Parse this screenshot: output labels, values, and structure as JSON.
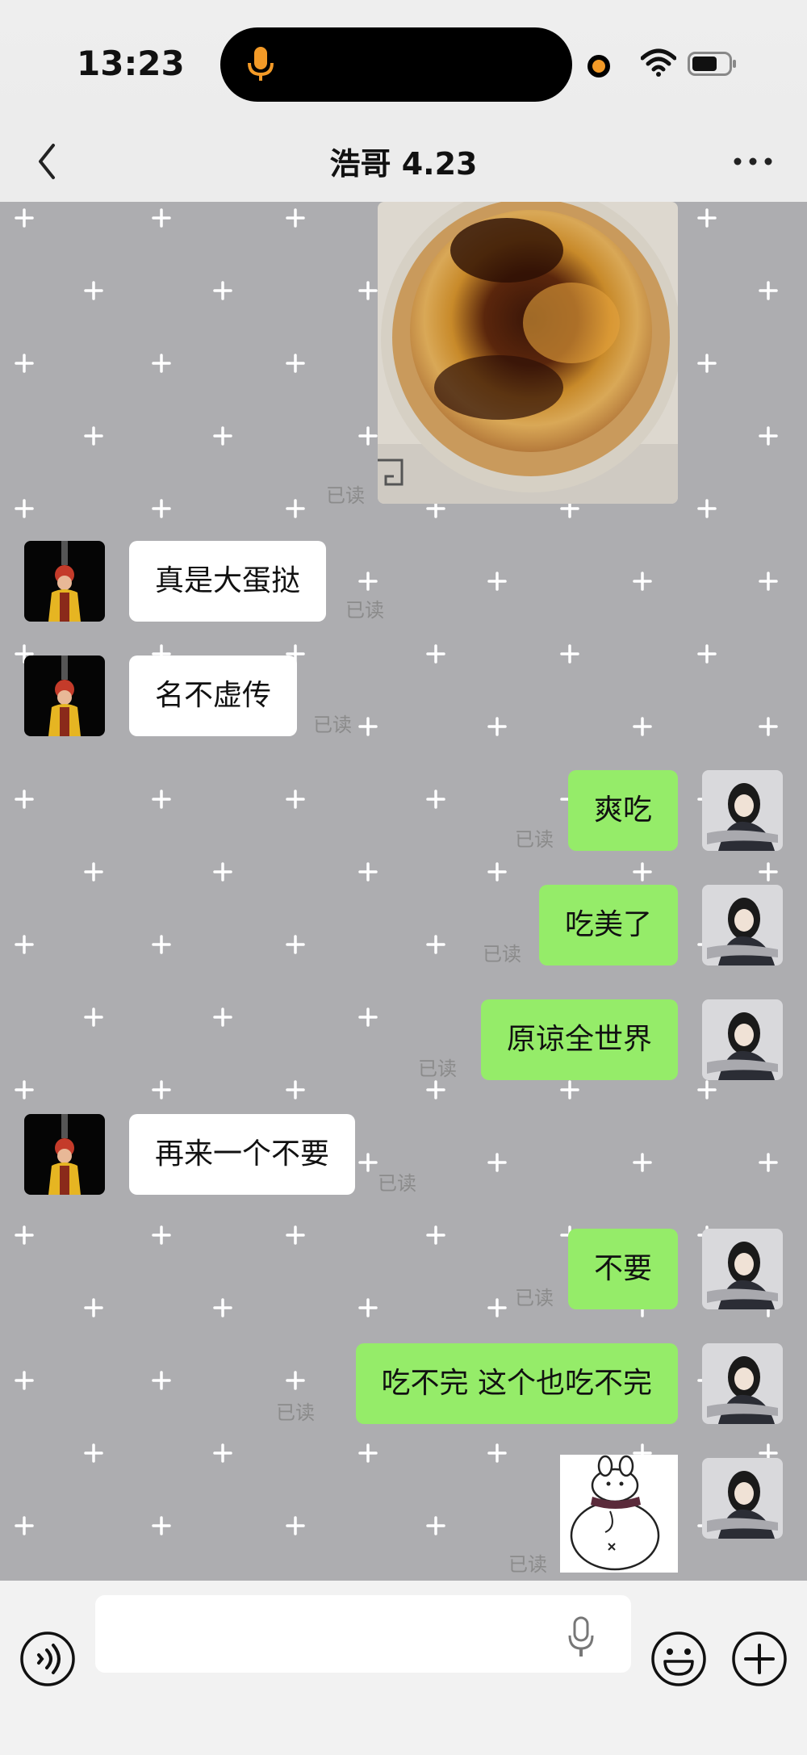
{
  "status_bar": {
    "time": "13:23"
  },
  "header": {
    "title": "浩哥 4.23"
  },
  "read_label": "已读",
  "messages": [
    {
      "side": "right",
      "type": "image",
      "content": "egg-tart-photo",
      "read": "已读"
    },
    {
      "side": "left",
      "type": "text",
      "text": "真是大蛋挞",
      "read": "已读"
    },
    {
      "side": "left",
      "type": "text",
      "text": "名不虚传",
      "read": "已读"
    },
    {
      "side": "right",
      "type": "text",
      "text": "爽吃",
      "read": "已读"
    },
    {
      "side": "right",
      "type": "text",
      "text": "吃美了",
      "read": "已读"
    },
    {
      "side": "right",
      "type": "text",
      "text": "原谅全世界",
      "read": "已读"
    },
    {
      "side": "left",
      "type": "text",
      "text": "再来一个不要",
      "read": "已读"
    },
    {
      "side": "right",
      "type": "text",
      "text": "不要",
      "read": "已读"
    },
    {
      "side": "right",
      "type": "text",
      "text": "吃不完 这个也吃不完",
      "read": "已读"
    },
    {
      "side": "right",
      "type": "sticker",
      "content": "bunny-sticker",
      "read": "已读"
    }
  ],
  "input": {
    "placeholder": "",
    "value": ""
  },
  "colors": {
    "sent_bubble": "#95ec69",
    "received_bubble": "#ffffff",
    "chat_bg": "#adadb0",
    "status_accent": "#f39a27"
  },
  "icons": [
    "mic-icon",
    "wifi-icon",
    "battery-icon",
    "back-icon",
    "more-icon",
    "voice-icon",
    "emoji-icon",
    "plus-icon"
  ]
}
